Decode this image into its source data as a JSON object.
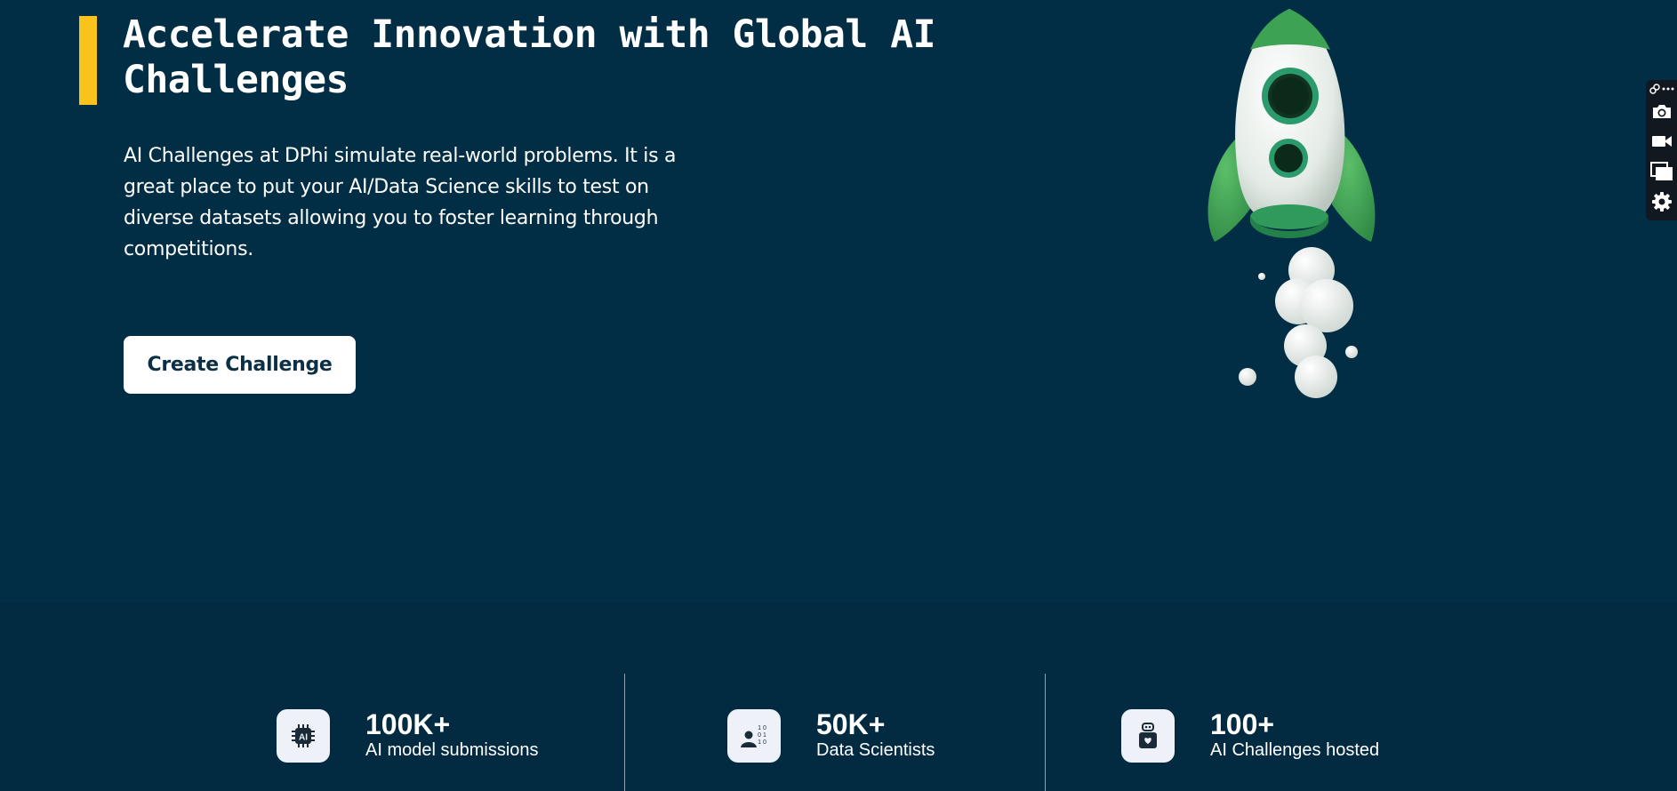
{
  "hero": {
    "title": "Accelerate Innovation with Global AI Challenges",
    "description": "AI Challenges at DPhi simulate real-world problems. It is a great place to put your AI/Data Science skills to test on diverse datasets allowing you to foster learning through competitions.",
    "cta_label": "Create Challenge",
    "accent_color": "#f9c31b",
    "background_color": "#022e45",
    "illustration": "rocket-illustration"
  },
  "toolbar": {
    "icons": [
      "link-icon",
      "more-icon",
      "camera-icon",
      "video-icon",
      "window-icon",
      "gear-icon"
    ]
  },
  "stats": [
    {
      "value": "100K+",
      "label": "AI model submissions",
      "icon": "ai-chip-icon"
    },
    {
      "value": "50K+",
      "label": "Data Scientists",
      "icon": "data-scientist-icon"
    },
    {
      "value": "100+",
      "label": "AI Challenges hosted",
      "icon": "robot-icon"
    }
  ]
}
